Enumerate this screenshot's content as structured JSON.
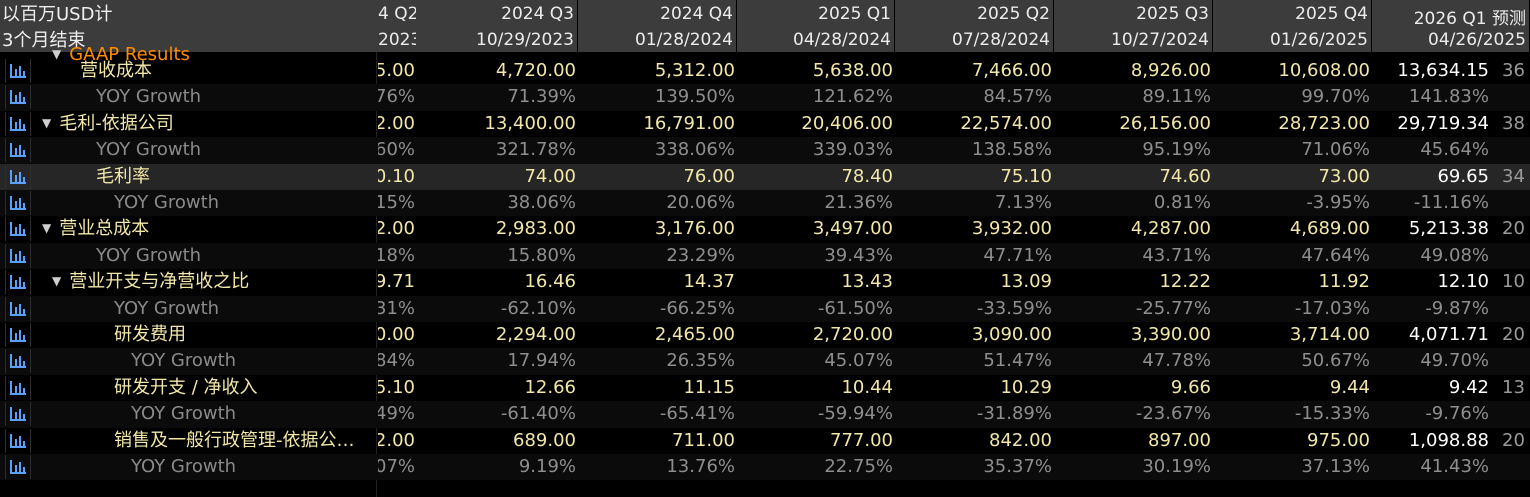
{
  "header": {
    "units": "以百万USD计",
    "period": "3个月结束",
    "partial_col_label": "4 Q2",
    "partial_col_date": "2023",
    "columns": [
      {
        "label": "2024 Q3",
        "date": "10/29/2023"
      },
      {
        "label": "2024 Q4",
        "date": "01/28/2024"
      },
      {
        "label": "2025 Q1",
        "date": "04/28/2024"
      },
      {
        "label": "2025 Q2",
        "date": "07/28/2024"
      },
      {
        "label": "2025 Q3",
        "date": "10/27/2024"
      },
      {
        "label": "2025 Q4",
        "date": "01/26/2025"
      },
      {
        "label": "2026 Q1 预测",
        "date": "04/26/2025"
      }
    ]
  },
  "section": {
    "label": "GAAP Results"
  },
  "rows": [
    {
      "label": "营收成本",
      "type": "metric",
      "partial": "5.00",
      "values": [
        "4,720.00",
        "5,312.00",
        "5,638.00",
        "7,466.00",
        "8,926.00",
        "10,608.00",
        "13,634.15"
      ],
      "tail": "36"
    },
    {
      "label": "YOY Growth",
      "type": "yoy",
      "partial": ".76%",
      "values": [
        "71.39%",
        "139.50%",
        "121.62%",
        "84.57%",
        "89.11%",
        "99.70%",
        "141.83%"
      ],
      "tail": ""
    },
    {
      "label": "毛利-依据公司",
      "type": "metric",
      "partial": "2.00",
      "values": [
        "13,400.00",
        "16,791.00",
        "20,406.00",
        "22,574.00",
        "26,156.00",
        "28,723.00",
        "29,719.34"
      ],
      "tail": "38"
    },
    {
      "label": "YOY Growth",
      "type": "yoy",
      "partial": ".60%",
      "values": [
        "321.78%",
        "338.06%",
        "339.03%",
        "138.58%",
        "95.19%",
        "71.06%",
        "45.64%"
      ],
      "tail": ""
    },
    {
      "label": "毛利率",
      "type": "metric",
      "partial": "0.10",
      "values": [
        "74.00",
        "76.00",
        "78.40",
        "75.10",
        "74.60",
        "73.00",
        "69.65"
      ],
      "tail": "34"
    },
    {
      "label": "YOY Growth",
      "type": "yoy",
      "partial": ".15%",
      "values": [
        "38.06%",
        "20.06%",
        "21.36%",
        "7.13%",
        "0.81%",
        "-3.95%",
        "-11.16%"
      ],
      "tail": ""
    },
    {
      "label": "营业总成本",
      "type": "metric",
      "partial": "2.00",
      "values": [
        "2,983.00",
        "3,176.00",
        "3,497.00",
        "3,932.00",
        "4,287.00",
        "4,689.00",
        "5,213.38"
      ],
      "tail": "20"
    },
    {
      "label": "YOY Growth",
      "type": "yoy",
      "partial": ".18%",
      "values": [
        "15.80%",
        "23.29%",
        "39.43%",
        "47.71%",
        "43.71%",
        "47.64%",
        "49.08%"
      ],
      "tail": ""
    },
    {
      "label": "营业开支与净营收之比",
      "type": "metric",
      "partial": "9.71",
      "values": [
        "16.46",
        "14.37",
        "13.43",
        "13.09",
        "12.22",
        "11.92",
        "12.10"
      ],
      "tail": "10"
    },
    {
      "label": "YOY Growth",
      "type": "yoy",
      "partial": ".31%",
      "values": [
        "-62.10%",
        "-66.25%",
        "-61.50%",
        "-33.59%",
        "-25.77%",
        "-17.03%",
        "-9.87%"
      ],
      "tail": ""
    },
    {
      "label": "研发费用",
      "type": "metric",
      "partial": "0.00",
      "values": [
        "2,294.00",
        "2,465.00",
        "2,720.00",
        "3,090.00",
        "3,390.00",
        "3,714.00",
        "4,071.71"
      ],
      "tail": "20"
    },
    {
      "label": "YOY Growth",
      "type": "yoy",
      "partial": ".84%",
      "values": [
        "17.94%",
        "26.35%",
        "45.07%",
        "51.47%",
        "47.78%",
        "50.67%",
        "49.70%"
      ],
      "tail": ""
    },
    {
      "label": "研发开支 / 净收入",
      "type": "metric",
      "partial": "5.10",
      "values": [
        "12.66",
        "11.15",
        "10.44",
        "10.29",
        "9.66",
        "9.44",
        "9.42"
      ],
      "tail": "13"
    },
    {
      "label": "YOY Growth",
      "type": "yoy",
      "partial": ".49%",
      "values": [
        "-61.40%",
        "-65.41%",
        "-59.94%",
        "-31.89%",
        "-23.67%",
        "-15.33%",
        "-9.76%"
      ],
      "tail": ""
    },
    {
      "label": "销售及一般行政管理-依据公…",
      "type": "metric",
      "partial": "2.00",
      "values": [
        "689.00",
        "711.00",
        "777.00",
        "842.00",
        "897.00",
        "975.00",
        "1,098.88"
      ],
      "tail": "20"
    },
    {
      "label": "YOY Growth",
      "type": "yoy",
      "partial": ".07%",
      "values": [
        "9.19%",
        "13.76%",
        "22.75%",
        "35.37%",
        "30.19%",
        "37.13%",
        "41.43%"
      ],
      "tail": ""
    }
  ]
}
